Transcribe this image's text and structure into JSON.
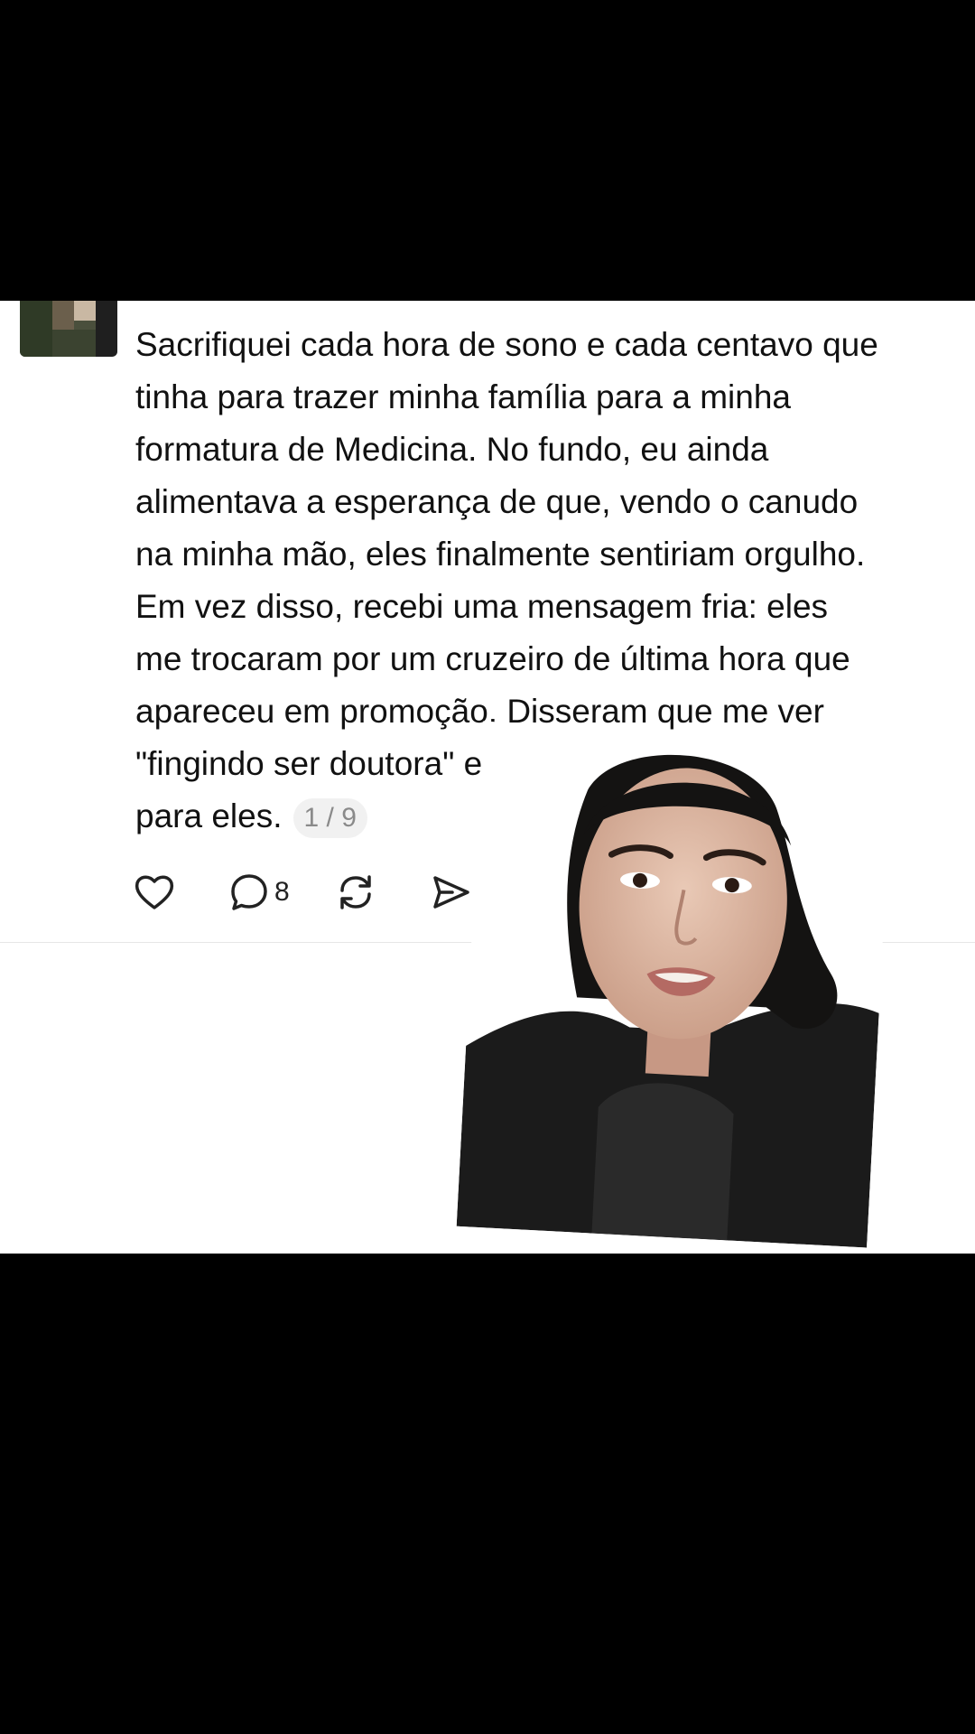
{
  "post": {
    "text": "Sacrifiquei cada hora de sono e cada centavo que\ntinha para trazer minha família para a minha\nformatura de Medicina. No fundo, eu ainda\nalimentava a esperança de que, vendo o canudo\nna minha mão, eles finalmente sentiriam orgulho.\nEm vez disso, recebi uma mensagem fria: eles\nme trocaram por um cruzeiro de última hora que\napareceu em promoção. Disseram que me ver\n\"fingindo ser doutora\" era vergonhoso demais\npara eles.",
    "counter": "1 / 9"
  },
  "actions": {
    "like_icon": "heart-icon",
    "reply_icon": "comment-icon",
    "reply_count": "8",
    "repost_icon": "repost-icon",
    "share_icon": "send-icon"
  },
  "colors": {
    "background": "#000000",
    "card": "#ffffff",
    "text": "#111111",
    "counter_text": "#8a8a8a",
    "counter_bg": "#f1f1f1",
    "divider": "#e6e6e6"
  }
}
